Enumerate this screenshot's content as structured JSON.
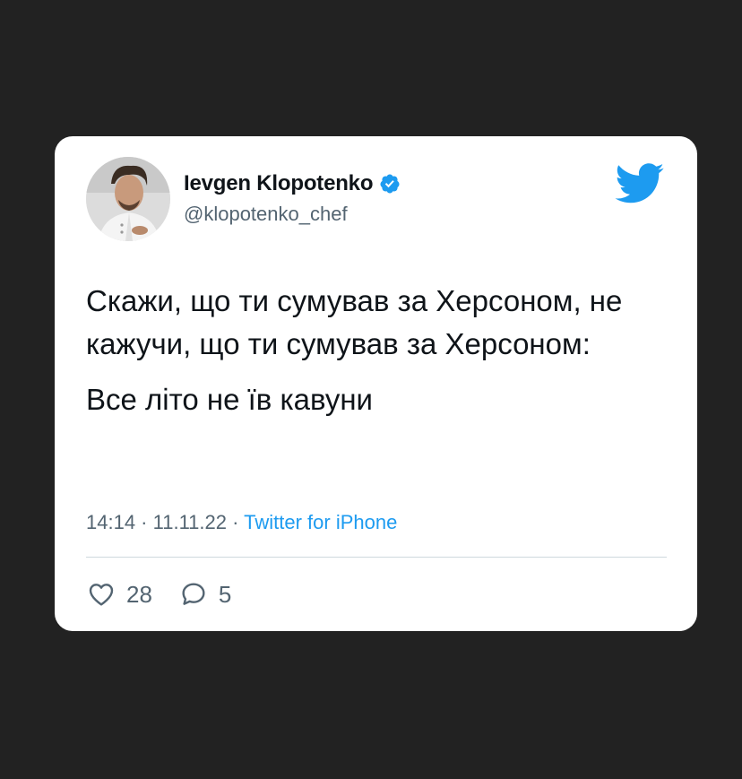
{
  "author": {
    "name": "Ievgen Klopotenko",
    "handle": "@klopotenko_chef",
    "verified": true,
    "avatar_icon": "avatar-photo"
  },
  "tweet": {
    "paragraphs": [
      "Скажи, що ти сумував за Херсоном, не кажучи, що ти сумував за Херсоном:",
      "Все літо не їв кавуни"
    ]
  },
  "meta": {
    "time": "14:14",
    "separator1": " · ",
    "date": "11.11.22",
    "separator2": " · ",
    "source": "Twitter for iPhone"
  },
  "actions": {
    "likes_count": "28",
    "replies_count": "5",
    "like_icon": "heart-icon",
    "reply_icon": "comment-icon"
  },
  "colors": {
    "background": "#222222",
    "card": "#ffffff",
    "brand_blue": "#1d9bf0",
    "text": "#0f1419",
    "muted": "#536471"
  }
}
